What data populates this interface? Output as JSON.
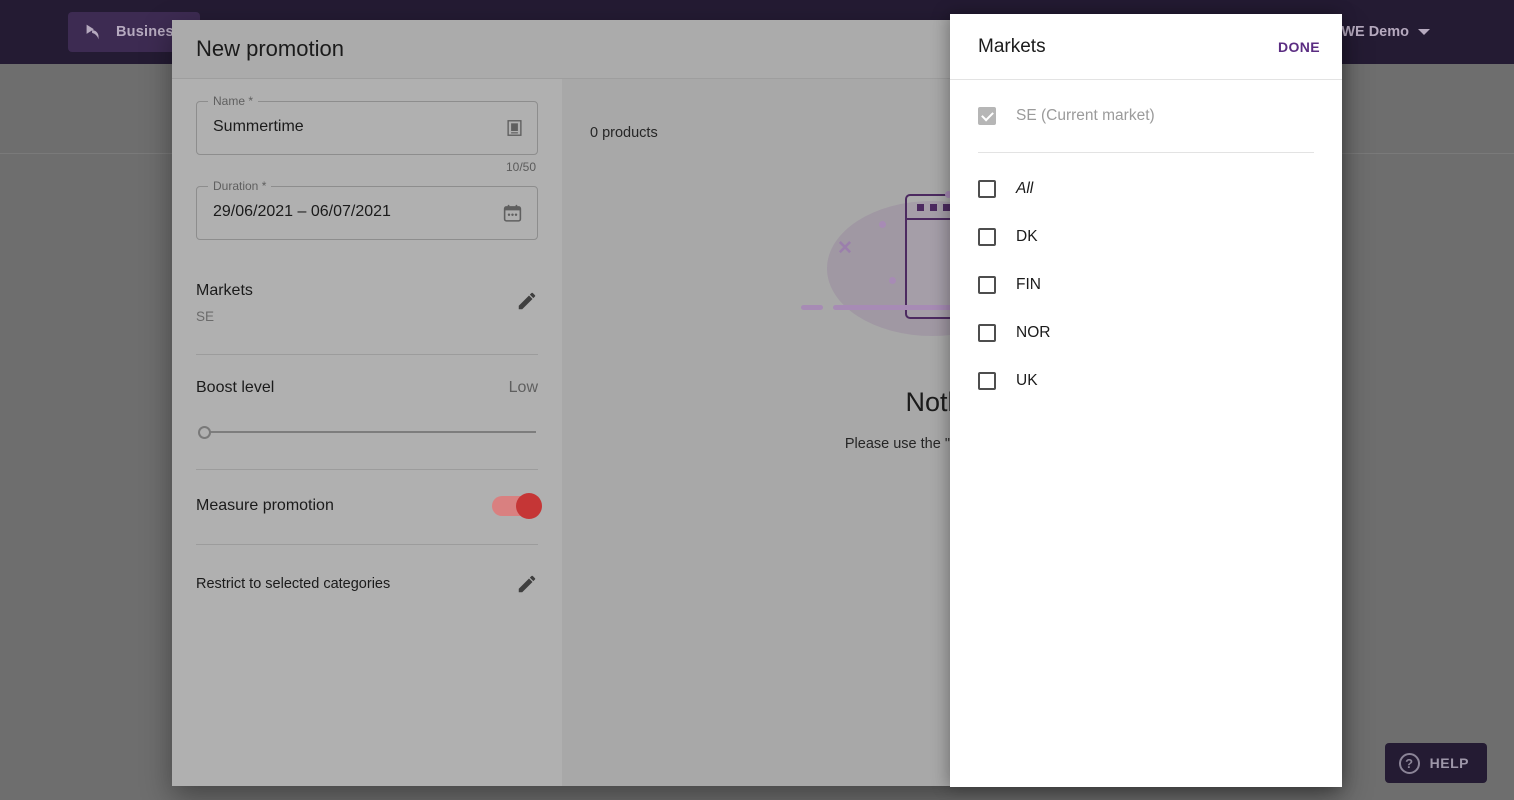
{
  "topbar": {
    "brand_label": "Business",
    "brand_logo_icon": "logo-icon",
    "account_label": "WE Demo",
    "account_caret_icon": "chevron-down-icon"
  },
  "help": {
    "label": "HELP",
    "icon": "question-mark-icon",
    "glyph": "?"
  },
  "dialog": {
    "title": "New promotion",
    "form": {
      "name_field": {
        "legend": "Name",
        "required_mark": "*",
        "value": "Summertime",
        "trailing_icon": "translate-field-icon",
        "counter": "10/50"
      },
      "duration_field": {
        "legend": "Duration",
        "required_mark": "*",
        "value": "29/06/2021  –  06/07/2021",
        "trailing_icon": "calendar-icon"
      },
      "markets_section": {
        "title": "Markets",
        "value": "SE",
        "edit_icon": "pencil-icon"
      },
      "boost_section": {
        "title": "Boost level",
        "value": "Low",
        "slider_position_percent": 0
      },
      "measure_section": {
        "title": "Measure promotion",
        "toggle_on": true,
        "toggle_color": "#c53636"
      },
      "restrict_section": {
        "title": "Restrict to selected categories",
        "edit_icon": "pencil-icon"
      }
    },
    "content": {
      "product_count": "0 products",
      "empty_title": "Nothing",
      "empty_subtitle": "Please use the \"Selection\" button",
      "illustration_icon": "empty-window-illustration"
    }
  },
  "markets_panel": {
    "title": "Markets",
    "done_label": "DONE",
    "current": {
      "label": "SE (Current market)",
      "checked": true,
      "disabled": true
    },
    "options": [
      {
        "label": "All",
        "checked": false,
        "italic": true
      },
      {
        "label": "DK",
        "checked": false,
        "italic": false
      },
      {
        "label": "FIN",
        "checked": false,
        "italic": false
      },
      {
        "label": "NOR",
        "checked": false,
        "italic": false
      },
      {
        "label": "UK",
        "checked": false,
        "italic": false
      }
    ]
  },
  "colors": {
    "topbar_bg": "#241b33",
    "accent_purple": "#5b2d82",
    "toggle_red": "#c53636",
    "illustration_purple": "#4c2a60"
  }
}
